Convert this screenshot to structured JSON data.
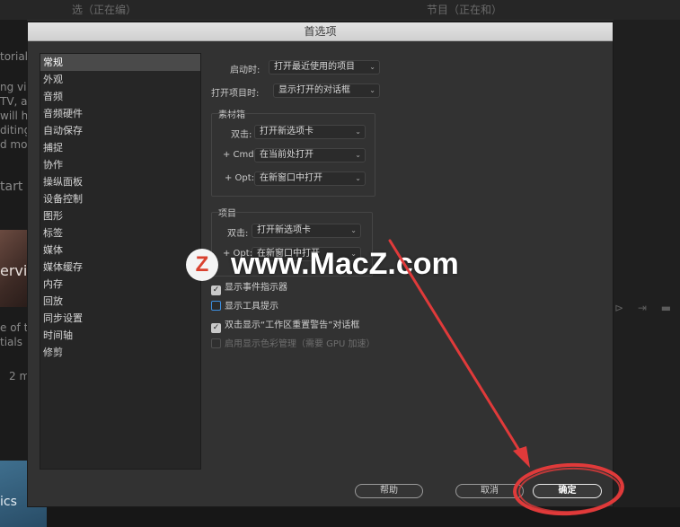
{
  "background": {
    "top_left_text": "选（正在编）",
    "top_right_text": "节目（正在和）",
    "left_fragments": [
      "torial",
      "ng vic",
      "TV, ar",
      "will h",
      "diting,",
      "d mor",
      "tart",
      "ervi",
      "e of th",
      "tials",
      "2 m"
    ],
    "thumb_label": "ics",
    "right_icons": "⊳ ⇥ ▬"
  },
  "dialog": {
    "title": "首选项",
    "sidebar": {
      "items": [
        "常规",
        "外观",
        "音频",
        "音频硬件",
        "自动保存",
        "捕捉",
        "协作",
        "操纵面板",
        "设备控制",
        "图形",
        "标签",
        "媒体",
        "媒体缓存",
        "内存",
        "回放",
        "同步设置",
        "时间轴",
        "修剪"
      ],
      "selected_index": 0
    },
    "general": {
      "startup_label": "启动时:",
      "startup_value": "打开最近使用的项目",
      "open_project_label": "打开项目时:",
      "open_project_value": "显示打开的对话框",
      "bin": {
        "title": "素材箱",
        "double_click_label": "双击:",
        "double_click_value": "打开新选项卡",
        "cmd_label": "+ Cmd:",
        "cmd_value": "在当前处打开",
        "opt_label": "+ Opt:",
        "opt_value": "在新窗口中打开"
      },
      "project": {
        "title": "项目",
        "double_click_label": "双击:",
        "double_click_value": "打开新选项卡",
        "opt_label": "+ Opt:",
        "opt_value": "在新窗口中打开"
      },
      "checkboxes": [
        {
          "label": "显示事件指示器",
          "checked": true,
          "enabled": true
        },
        {
          "label": "显示工具提示",
          "checked": false,
          "enabled": true
        },
        {
          "label": "双击显示“工作区重置警告”对话框",
          "checked": true,
          "enabled": true
        },
        {
          "label": "启用显示色彩管理（需要 GPU 加速）",
          "checked": false,
          "enabled": false
        }
      ]
    },
    "buttons": {
      "help": "帮助",
      "cancel": "取消",
      "ok": "确定"
    }
  },
  "watermark": {
    "logo_letter": "Z",
    "text": "www.MacZ.com"
  },
  "annotation_color": "#e03a3a"
}
